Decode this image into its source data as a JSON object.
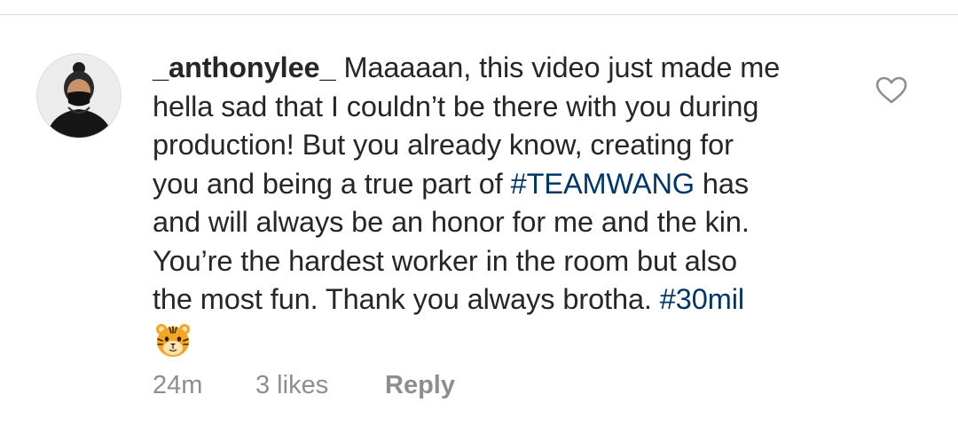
{
  "comment": {
    "username": "_anthonylee_",
    "lines": [
      {
        "pre": " Maaaaan, this video just made me",
        "tag": "",
        "post": ""
      },
      {
        "pre": "hella sad that I couldn’t be there with you during",
        "tag": "",
        "post": ""
      },
      {
        "pre": "production! But you already know, creating for",
        "tag": "",
        "post": ""
      },
      {
        "pre": "you and being a true part of ",
        "tag": "#TEAMWANG",
        "post": " has"
      },
      {
        "pre": "and will always be an honor for me and the kin.",
        "tag": "",
        "post": ""
      },
      {
        "pre": "You’re the hardest worker in the room but also",
        "tag": "",
        "post": ""
      },
      {
        "pre": "the most fun. Thank you always brotha. ",
        "tag": "#30mil",
        "post": ""
      }
    ],
    "emoji": "tiger-face",
    "time": "24m",
    "likes": "3 likes",
    "reply_label": "Reply"
  },
  "colors": {
    "text": "#262626",
    "hashtag": "#00376b",
    "meta": "#8e8e8e"
  },
  "icons": {
    "like": "heart-outline-icon",
    "avatar": "user-avatar"
  }
}
